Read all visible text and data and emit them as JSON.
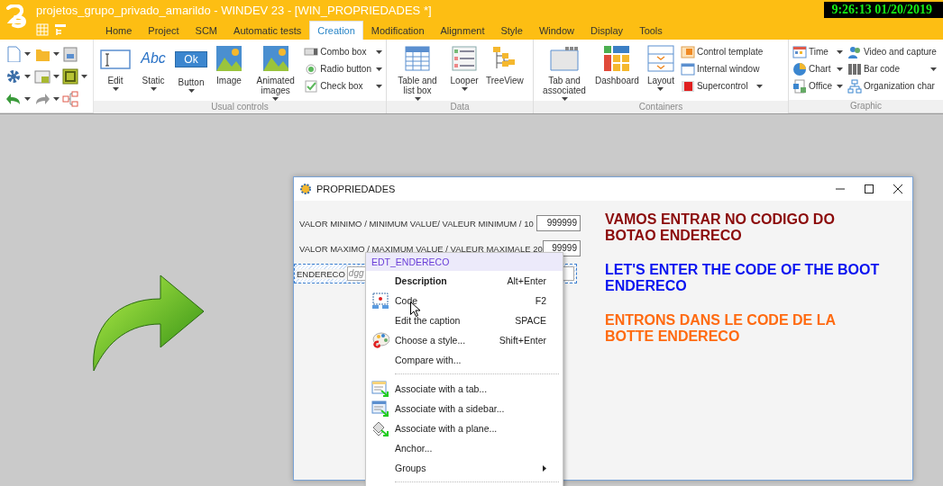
{
  "title_bar": {
    "title": "projetos_grupo_privado_amarildo - WINDEV 23 - [WIN_PROPRIEDADES *]",
    "clock": "9:26:13  01/20/2019"
  },
  "ribbon_tabs": [
    {
      "label": "Home",
      "selected": false
    },
    {
      "label": "Project",
      "selected": false
    },
    {
      "label": "SCM",
      "selected": false
    },
    {
      "label": "Automatic tests",
      "selected": false
    },
    {
      "label": "Creation",
      "selected": true
    },
    {
      "label": "Modification",
      "selected": false
    },
    {
      "label": "Alignment",
      "selected": false
    },
    {
      "label": "Style",
      "selected": false
    },
    {
      "label": "Window",
      "selected": false
    },
    {
      "label": "Display",
      "selected": false
    },
    {
      "label": "Tools",
      "selected": false
    }
  ],
  "ribbon_groups": [
    {
      "label": "Usual controls",
      "buttons": [
        {
          "label": "Edit",
          "dropdown": true
        },
        {
          "label": "Static",
          "dropdown": true,
          "icon_text": "Abc"
        },
        {
          "label": "Button",
          "dropdown": true,
          "icon_text": "Ok"
        },
        {
          "label": "Image",
          "dropdown": false
        },
        {
          "label": "Animated images",
          "dropdown": true
        }
      ],
      "small_buttons": [
        {
          "label": "Combo box",
          "dropdown": true
        },
        {
          "label": "Radio button",
          "dropdown": true
        },
        {
          "label": "Check box",
          "dropdown": true
        }
      ]
    },
    {
      "label": "Data",
      "buttons": [
        {
          "label": "Table and list box",
          "dropdown": true
        },
        {
          "label": "Looper",
          "dropdown": true
        },
        {
          "label": "TreeView",
          "dropdown": false
        }
      ]
    },
    {
      "label": "Containers",
      "buttons": [
        {
          "label": "Tab and associated",
          "dropdown": true
        },
        {
          "label": "Dashboard",
          "dropdown": false
        },
        {
          "label": "Layout",
          "dropdown": true
        }
      ],
      "small_buttons": [
        {
          "label": "Control template",
          "dropdown": false
        },
        {
          "label": "Internal window",
          "dropdown": false
        },
        {
          "label": "Supercontrol",
          "dropdown": true
        }
      ]
    },
    {
      "label": "Graphic",
      "small_buttons": [
        {
          "label": "Time",
          "dropdown": true
        },
        {
          "label": "Chart",
          "dropdown": true
        },
        {
          "label": "Office",
          "dropdown": true
        },
        {
          "label": "Video and capture",
          "dropdown": false
        },
        {
          "label": "Bar code",
          "dropdown": true
        },
        {
          "label": "Organization char",
          "dropdown": false
        }
      ]
    }
  ],
  "window": {
    "title": "PROPRIEDADES",
    "fields": [
      {
        "label": "VALOR MINIMO / MINIMUM VALUE/ VALEUR MINIMUM / 10",
        "value": "999999",
        "kind": "number"
      },
      {
        "label": "VALOR MAXIMO / MAXIMUM VALUE / VALEUR MAXIMALE 20",
        "value": "99999",
        "kind": "number"
      },
      {
        "label": "ENDERECO",
        "placeholder": "dgg",
        "kind": "text"
      }
    ],
    "messages": [
      {
        "lines": [
          "VAMOS ENTRAR NO CODIGO DO",
          "BOTAO ENDERECO"
        ],
        "color": "#8b0a0a"
      },
      {
        "lines": [
          "LET'S ENTER THE CODE OF THE BOOT",
          "ENDERECO"
        ],
        "color": "#0a14f0"
      },
      {
        "lines": [
          "ENTRONS DANS LE CODE DE LA",
          "BOTTE ENDERECO"
        ],
        "color": "#ff6a10"
      }
    ]
  },
  "context_menu": {
    "header": "EDT_ENDERECO",
    "items": [
      {
        "kind": "item",
        "label": "Description",
        "shortcut": "Alt+Enter",
        "bold": true,
        "submenu": false
      },
      {
        "kind": "item",
        "label": "Code",
        "shortcut": "F2",
        "bold": false,
        "submenu": false
      },
      {
        "kind": "item",
        "label": "Edit the caption",
        "shortcut": "SPACE",
        "bold": false,
        "submenu": false
      },
      {
        "kind": "item",
        "label": "Choose a style...",
        "shortcut": "Shift+Enter",
        "bold": false,
        "submenu": false
      },
      {
        "kind": "item",
        "label": "Compare with...",
        "bold": false,
        "submenu": false
      },
      {
        "kind": "separator"
      },
      {
        "kind": "item",
        "label": "Associate with a tab...",
        "bold": false,
        "submenu": false
      },
      {
        "kind": "item",
        "label": "Associate with a sidebar...",
        "bold": false,
        "submenu": false
      },
      {
        "kind": "item",
        "label": "Associate with a plane...",
        "bold": false,
        "submenu": false
      },
      {
        "kind": "item",
        "label": "Anchor...",
        "bold": false,
        "submenu": false
      },
      {
        "kind": "item",
        "label": "Groups",
        "bold": false,
        "submenu": true
      },
      {
        "kind": "separator"
      }
    ]
  }
}
